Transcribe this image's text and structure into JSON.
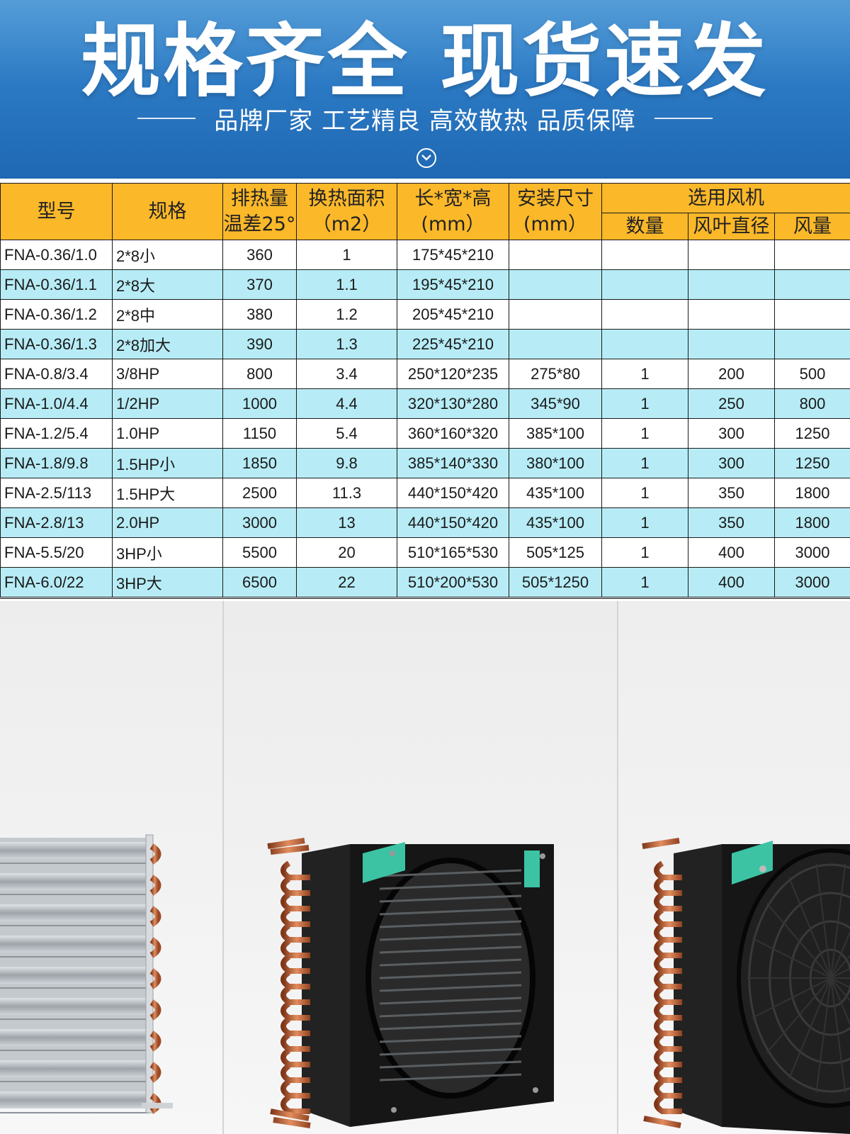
{
  "banner": {
    "headline": "规格齐全 现货速发",
    "tagline": "品牌厂家 工艺精良 高效散热 品质保障",
    "chevron_icon": "chevron-down-circle-icon"
  },
  "table": {
    "headers": {
      "model": "型号",
      "spec": "规格",
      "heat_rejection_line1": "排热量",
      "heat_rejection_line2": "温差25°",
      "area_line1": "换热面积",
      "area_line2": "（m2）",
      "dims_line1": "长*宽*高",
      "dims_line2": "(mm）",
      "install_line1": "安装尺寸",
      "install_line2": "(mm）",
      "fan_group": "选用风机",
      "fan_qty": "数量",
      "fan_diameter": "风叶直径",
      "fan_airflow": "风量"
    },
    "rows": [
      {
        "model": "FNA-0.36/1.0",
        "spec": "2*8小",
        "heat": "360",
        "area": "1",
        "dims": "175*45*210",
        "install": "",
        "qty": "",
        "dia": "",
        "air": ""
      },
      {
        "model": "FNA-0.36/1.1",
        "spec": "2*8大",
        "heat": "370",
        "area": "1.1",
        "dims": "195*45*210",
        "install": "",
        "qty": "",
        "dia": "",
        "air": ""
      },
      {
        "model": "FNA-0.36/1.2",
        "spec": "2*8中",
        "heat": "380",
        "area": "1.2",
        "dims": "205*45*210",
        "install": "",
        "qty": "",
        "dia": "",
        "air": ""
      },
      {
        "model": "FNA-0.36/1.3",
        "spec": "2*8加大",
        "heat": "390",
        "area": "1.3",
        "dims": "225*45*210",
        "install": "",
        "qty": "",
        "dia": "",
        "air": ""
      },
      {
        "model": "FNA-0.8/3.4",
        "spec": "3/8HP",
        "heat": "800",
        "area": "3.4",
        "dims": "250*120*235",
        "install": "275*80",
        "qty": "1",
        "dia": "200",
        "air": "500"
      },
      {
        "model": "FNA-1.0/4.4",
        "spec": "1/2HP",
        "heat": "1000",
        "area": "4.4",
        "dims": "320*130*280",
        "install": "345*90",
        "qty": "1",
        "dia": "250",
        "air": "800"
      },
      {
        "model": "FNA-1.2/5.4",
        "spec": "1.0HP",
        "heat": "1150",
        "area": "5.4",
        "dims": "360*160*320",
        "install": "385*100",
        "qty": "1",
        "dia": "300",
        "air": "1250"
      },
      {
        "model": "FNA-1.8/9.8",
        "spec": "1.5HP小",
        "heat": "1850",
        "area": "9.8",
        "dims": "385*140*330",
        "install": "380*100",
        "qty": "1",
        "dia": "300",
        "air": "1250"
      },
      {
        "model": "FNA-2.5/113",
        "spec": "1.5HP大",
        "heat": "2500",
        "area": "11.3",
        "dims": "440*150*420",
        "install": "435*100",
        "qty": "1",
        "dia": "350",
        "air": "1800"
      },
      {
        "model": "FNA-2.8/13",
        "spec": "2.0HP",
        "heat": "3000",
        "area": "13",
        "dims": "440*150*420",
        "install": "435*100",
        "qty": "1",
        "dia": "350",
        "air": "1800"
      },
      {
        "model": "FNA-5.5/20",
        "spec": "3HP小",
        "heat": "5500",
        "area": "20",
        "dims": "510*165*530",
        "install": "505*125",
        "qty": "1",
        "dia": "400",
        "air": "3000"
      },
      {
        "model": "FNA-6.0/22",
        "spec": "3HP大",
        "heat": "6500",
        "area": "22",
        "dims": "510*200*530",
        "install": "505*1250",
        "qty": "1",
        "dia": "400",
        "air": "3000"
      }
    ],
    "colors": {
      "header": "#fbb829",
      "stripe": "#b7ecf6",
      "plain": "#ffffff"
    }
  },
  "photos": {
    "panel_1": "condenser-coil-image",
    "panel_2": "condenser-with-fan-shroud-image",
    "panel_3": "condenser-with-fan-image",
    "colors": {
      "frame": "#141414",
      "copper": "#c06a3c",
      "aluminum": "#b9bec3",
      "label": "#3cc3a3"
    }
  }
}
